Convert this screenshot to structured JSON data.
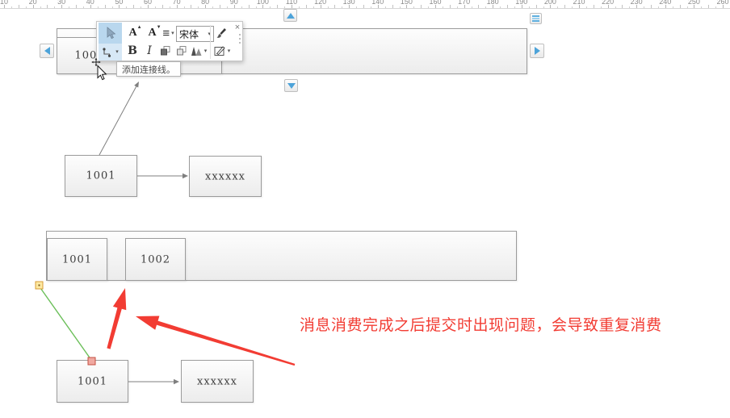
{
  "ruler": {
    "labels": [
      "10",
      "20",
      "30",
      "40",
      "50",
      "60",
      "70",
      "80",
      "90",
      "100",
      "110",
      "120",
      "130",
      "140",
      "150",
      "160",
      "170",
      "180",
      "190",
      "200",
      "210",
      "220",
      "230",
      "240",
      "250",
      "260"
    ]
  },
  "toolbar": {
    "font_family_value": "宋体",
    "bold_label": "B",
    "italic_label": "I",
    "font_increase_label": "A",
    "font_decrease_label": "A"
  },
  "icons": {
    "caret_down": "▾",
    "align_lines": "≡",
    "close": "×"
  },
  "tooltip": {
    "text": "添加连接线。"
  },
  "diagram": {
    "top_container": {
      "box1_label": "1001"
    },
    "mid_flow": {
      "source_label": "1001",
      "target_label": "xxxxxx"
    },
    "bottom_container": {
      "box1_label": "1001",
      "box2_label": "1002"
    },
    "bottom_flow": {
      "source_label": "1001",
      "target_label": "xxxxxx"
    },
    "annotation_text": "消息消费完成之后提交时出现问题，会导致重复消费"
  },
  "colors": {
    "annotation_red": "#f23c33",
    "connector_green": "#6bbf59",
    "accent_blue": "#4da3d9",
    "shape_border": "#9b9b9b"
  }
}
